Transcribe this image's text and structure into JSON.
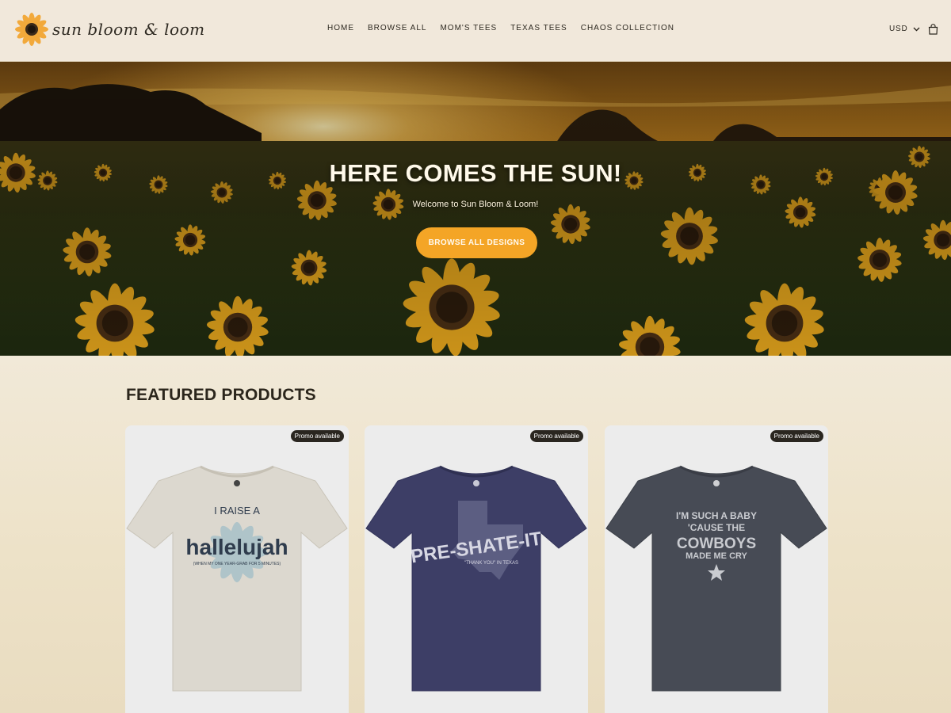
{
  "brand": {
    "name": "sun bloom & loom"
  },
  "nav": {
    "items": [
      "HOME",
      "BROWSE ALL",
      "MOM'S TEES",
      "TEXAS TEES",
      "CHAOS COLLECTION"
    ]
  },
  "header": {
    "currency": "USD"
  },
  "hero": {
    "title": "HERE COMES THE SUN!",
    "subtitle": "Welcome to Sun Bloom & Loom!",
    "cta": "BROWSE ALL DESIGNS"
  },
  "featured": {
    "title": "FEATURED PRODUCTS",
    "products": [
      {
        "badge": "Promo available",
        "shirt_color": "#dcd8cf",
        "print_lines": [
          "I RAISE A",
          "hallelujah",
          "(WHEN MY ONE YEAR-GRAB FOR 5 MINUTES)"
        ]
      },
      {
        "badge": "Promo available",
        "shirt_color": "#3d3e66",
        "print_lines": [
          "PRE-SHATE-IT",
          "\"THANK YOU\" IN TEXAS"
        ]
      },
      {
        "badge": "Promo available",
        "shirt_color": "#474b55",
        "print_lines": [
          "I'M SUCH A BABY",
          "'CAUSE THE",
          "COWBOYS",
          "MADE ME CRY"
        ]
      }
    ]
  },
  "colors": {
    "accent": "#f4a526",
    "header_bg": "#f1e8db",
    "badge_bg": "#2a2620"
  }
}
